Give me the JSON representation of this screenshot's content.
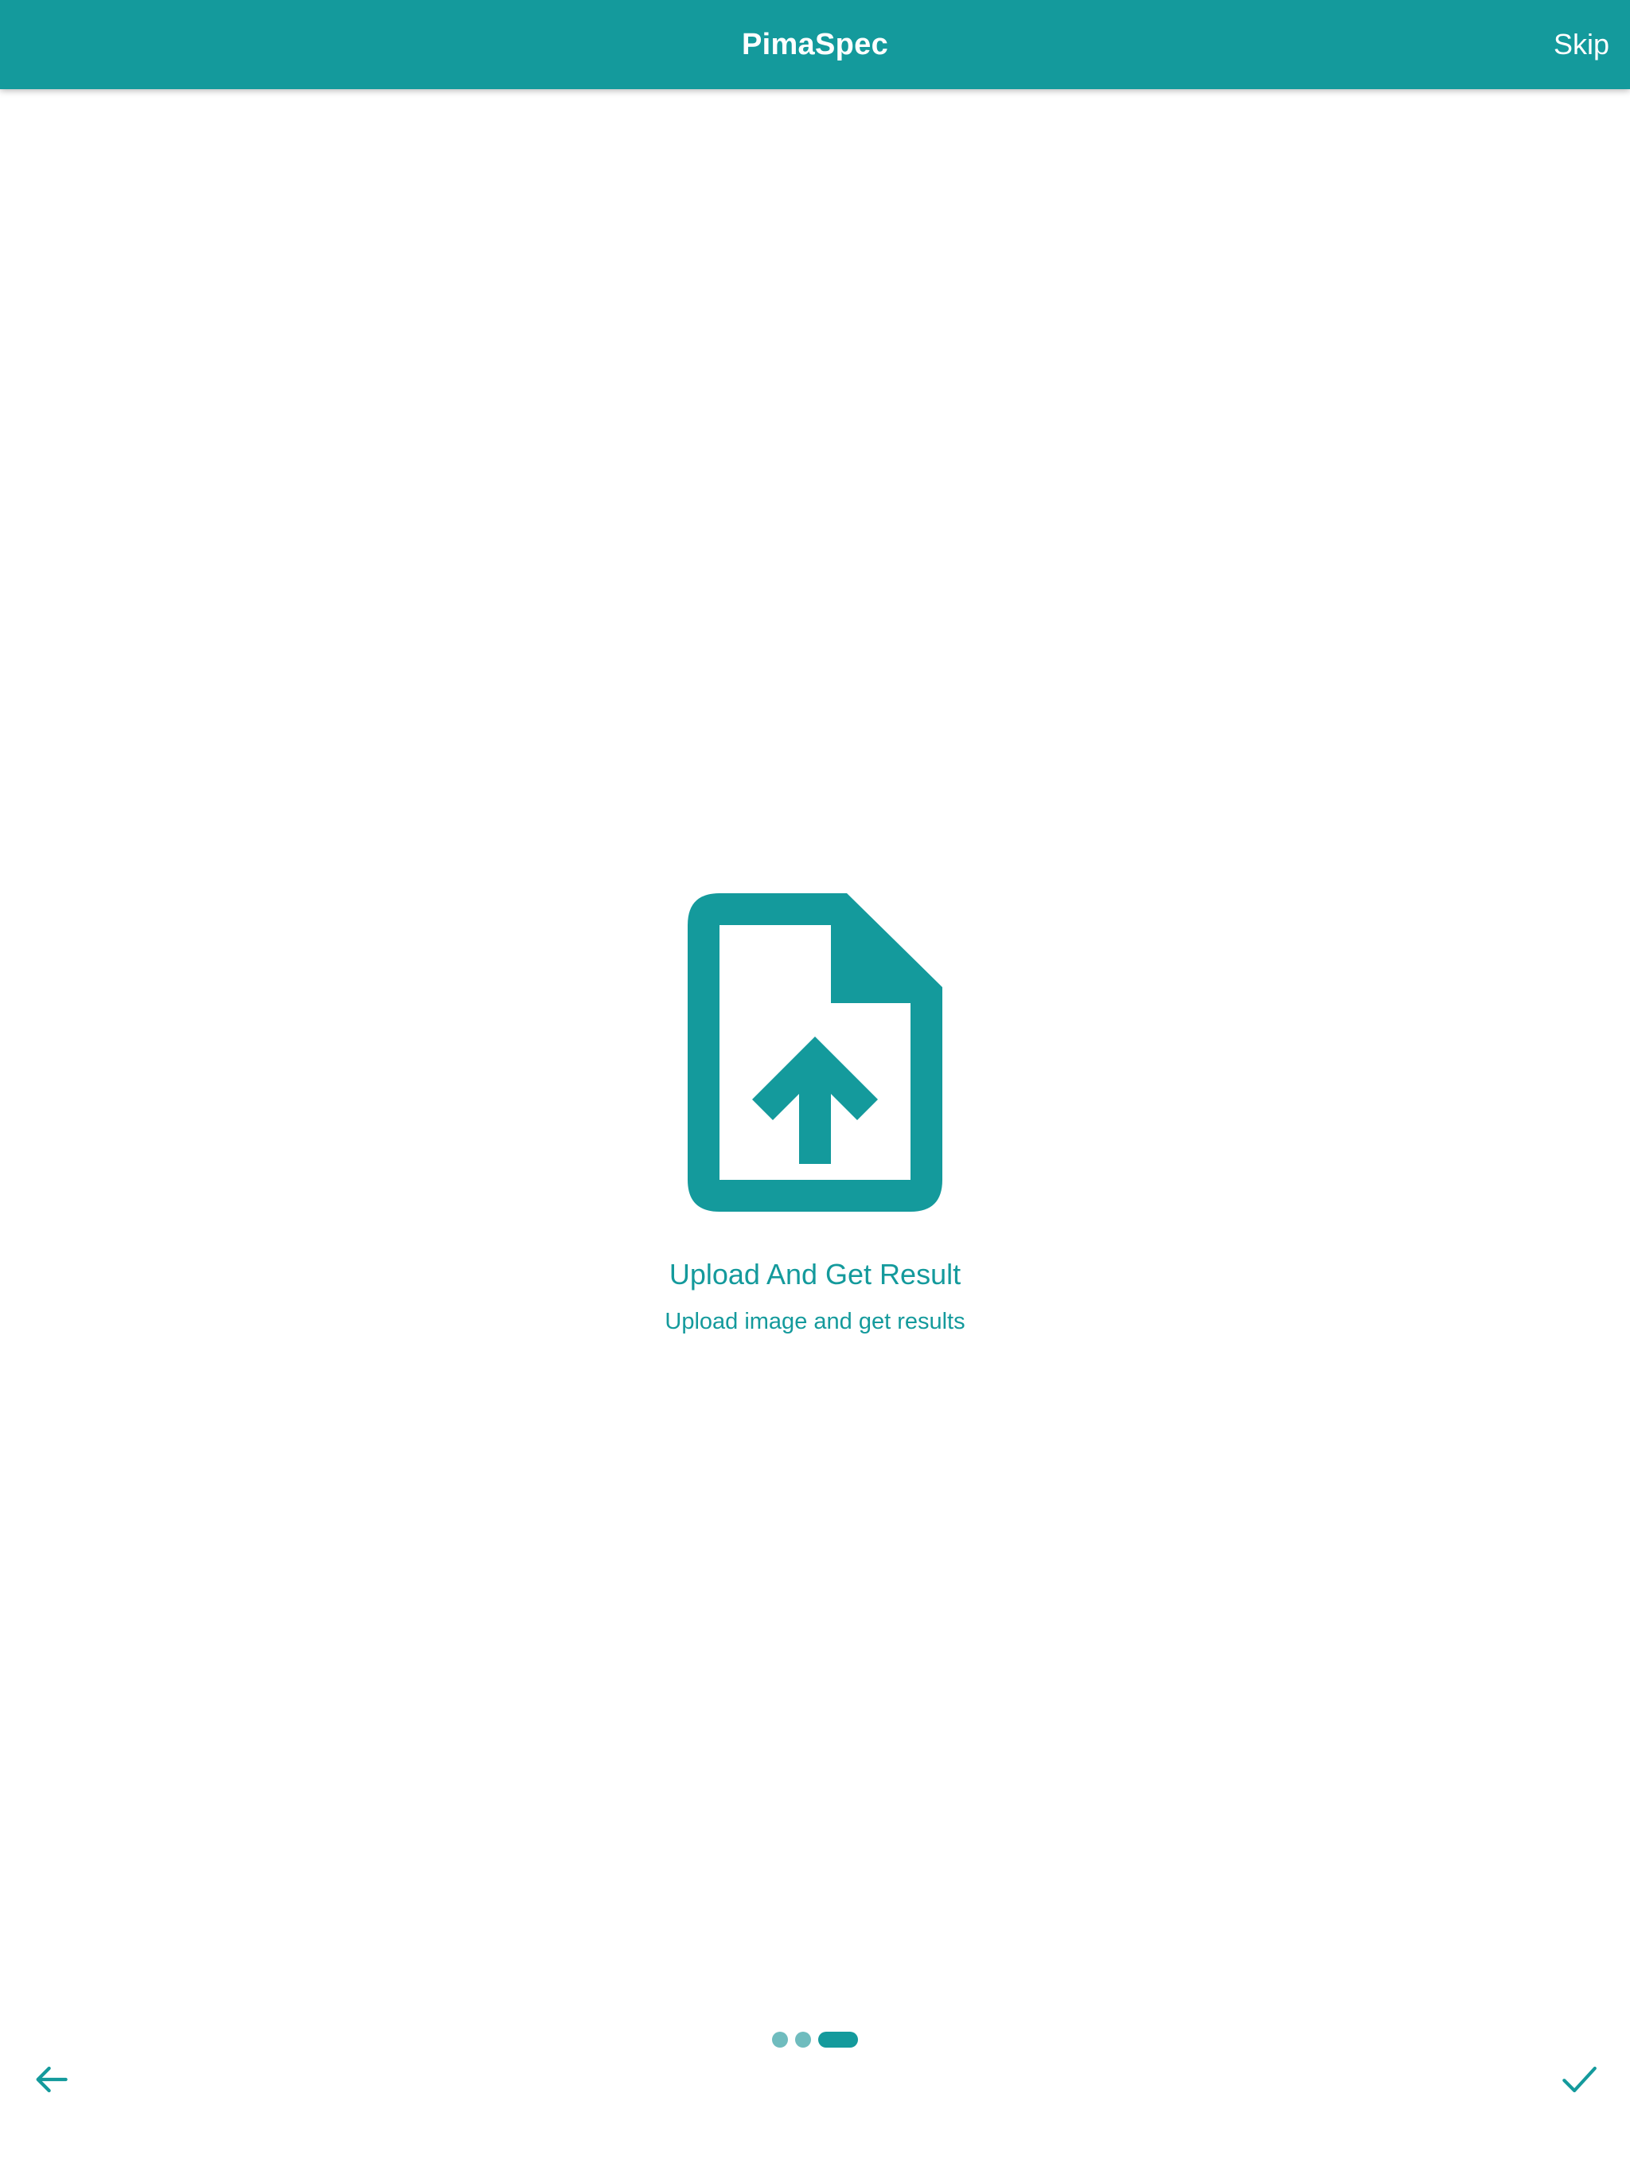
{
  "app_bar": {
    "title": "PimaSpec",
    "skip_label": "Skip"
  },
  "slide": {
    "icon": "upload-file-icon",
    "title": "Upload And Get Result",
    "subtitle": "Upload image and get results"
  },
  "pager": {
    "total": 3,
    "current": 3
  },
  "nav": {
    "back_icon": "arrow-back-icon",
    "done_icon": "check-icon"
  },
  "colors": {
    "primary": "#149a9c",
    "dot_inactive": "#6fbcbe",
    "background": "#ffffff"
  }
}
